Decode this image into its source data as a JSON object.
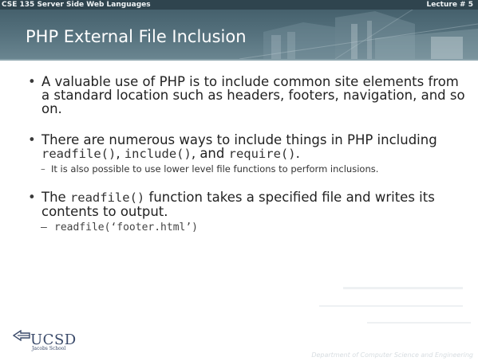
{
  "header": {
    "course": "CSE 135 Server Side Web Languages",
    "lecture": "Lecture # 5",
    "title": "PHP External File Inclusion"
  },
  "bullets": {
    "b1": "A valuable use of PHP is to include common site elements from a standard location such as headers, footers, navigation, and so on.",
    "b2": {
      "part1": "There are numerous ways to include things in PHP including ",
      "code1": "readfile()",
      "sep1": ", ",
      "code2": "include()",
      "sep2": ", and ",
      "code3": "require()",
      "end": ".",
      "sub": "It is also possible to use lower level file functions to perform inclusions."
    },
    "b3": {
      "part1": "The ",
      "code": "readfile()",
      "part2": " function takes a specified file and writes its contents to output.",
      "sub": "readfile(‘footer.html’)"
    }
  },
  "logo": {
    "name": "UCSD",
    "sub": "Jacobs School"
  },
  "footer": "Department of Computer Science and Engineering"
}
